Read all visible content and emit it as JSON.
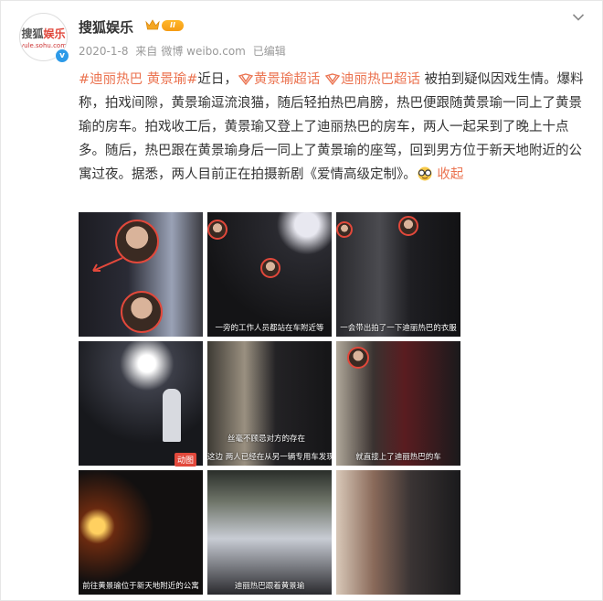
{
  "header": {
    "avatar_logo_a": "搜狐",
    "avatar_logo_b": "娱乐",
    "avatar_logo_sub": "yule.sohu.com",
    "verified_mark": "v",
    "username": "搜狐娱乐",
    "level_badge": "II",
    "date": "2020-1-8",
    "source_prefix": "来自",
    "source": "微博 weibo.com",
    "edited": "已编辑"
  },
  "post": {
    "topic": "#迪丽热巴 黄景瑜#",
    "text_a": "近日，",
    "super_topic_1": "黄景瑜超话",
    "super_topic_2": "迪丽热巴超话",
    "body": " 被拍到疑似因戏生情。爆料称，拍戏间隙，黄景瑜逗流浪猫，随后轻拍热巴肩膀，热巴便跟随黄景瑜一同上了黄景瑜的房车。拍戏收工后，黄景瑜又登上了迪丽热巴的房车，两人一起呆到了晚上十点多。随后，热巴跟在黄景瑜身后一同上了黄景瑜的座驾，回到男方位于新天地附近的公寓过夜。据悉，两人目前正在拍摄新剧《爱情高级定制》。",
    "collapse_link": "收起"
  },
  "images": [
    {
      "caption": ""
    },
    {
      "caption": "一旁的工作人员都站在车附近等"
    },
    {
      "caption": "一会带出拍了一下迪丽热巴的衣服"
    },
    {
      "caption": ""
    },
    {
      "caption": "这边 两人已经在从另一辆专用车发现"
    },
    {
      "caption": "就直接上了迪丽热巴的车"
    },
    {
      "caption": "前往黄景瑜位于新天地附近的公寓"
    },
    {
      "caption": "迪丽热巴跟着黄景瑜"
    },
    {
      "caption": ""
    }
  ],
  "image_overlays": {
    "overlay_5": "丝毫不顾忌对方的存在",
    "gif_badge": "动图"
  },
  "colors": {
    "link": "#eb7350",
    "verified": "#2d9ae8",
    "level": "#f59b13",
    "circle": "#e2483b"
  },
  "icons": [
    "crown-icon",
    "chevron-down-icon",
    "super-topic-icon",
    "glasses-emoji-icon"
  ]
}
